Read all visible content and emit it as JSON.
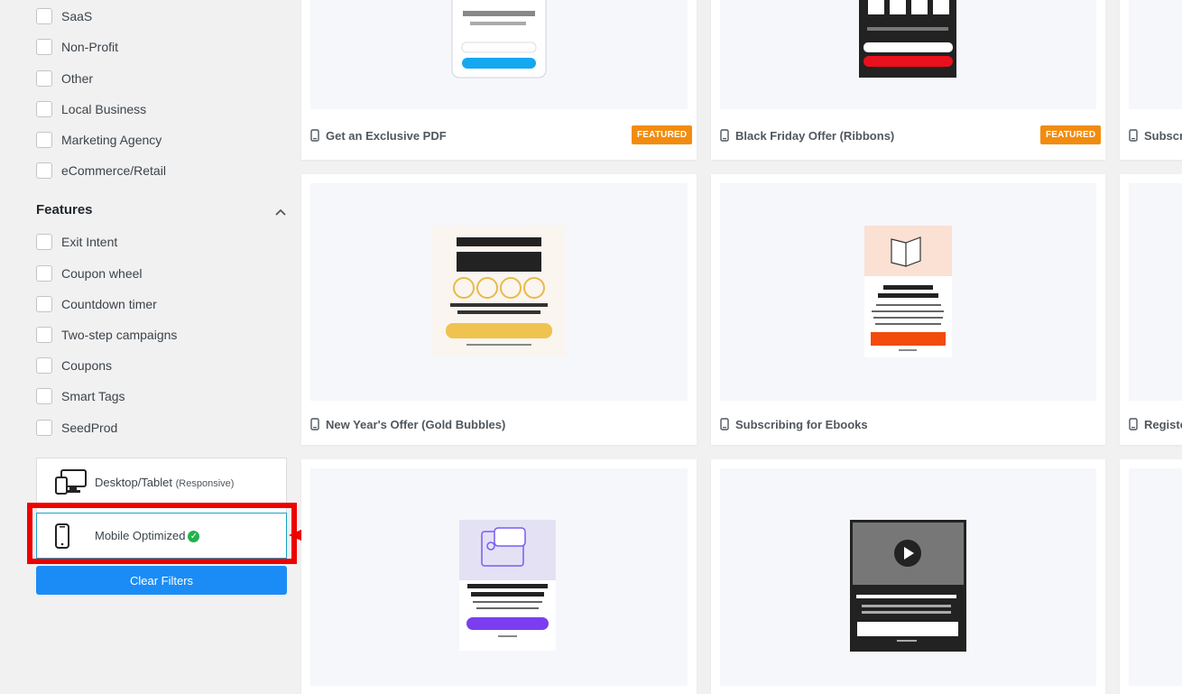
{
  "industries": [
    "SaaS",
    "Non-Profit",
    "Other",
    "Local Business",
    "Marketing Agency",
    "eCommerce/Retail"
  ],
  "features": {
    "title": "Features",
    "items": [
      "Exit Intent",
      "Coupon wheel",
      "Countdown timer",
      "Two-step campaigns",
      "Coupons",
      "Smart Tags",
      "SeedProd"
    ]
  },
  "devices": {
    "desktop_label": "Desktop/Tablet",
    "desktop_sub": "(Responsive)",
    "mobile_label": "Mobile Optimized",
    "mobile_check": "✓"
  },
  "clear_filters": "Clear Filters",
  "templates": [
    {
      "title": "Get an Exclusive PDF",
      "badge": "FEATURED"
    },
    {
      "title": "Black Friday Offer (Ribbons)",
      "badge": "FEATURED"
    },
    {
      "title": "Subscri"
    },
    {
      "title": "New Year's Offer (Gold Bubbles)"
    },
    {
      "title": "Subscribing for Ebooks"
    },
    {
      "title": "Registe"
    }
  ],
  "colors": {
    "accent": "#1b8cf5",
    "featured": "#f28c0f",
    "highlight": "#e00000"
  }
}
